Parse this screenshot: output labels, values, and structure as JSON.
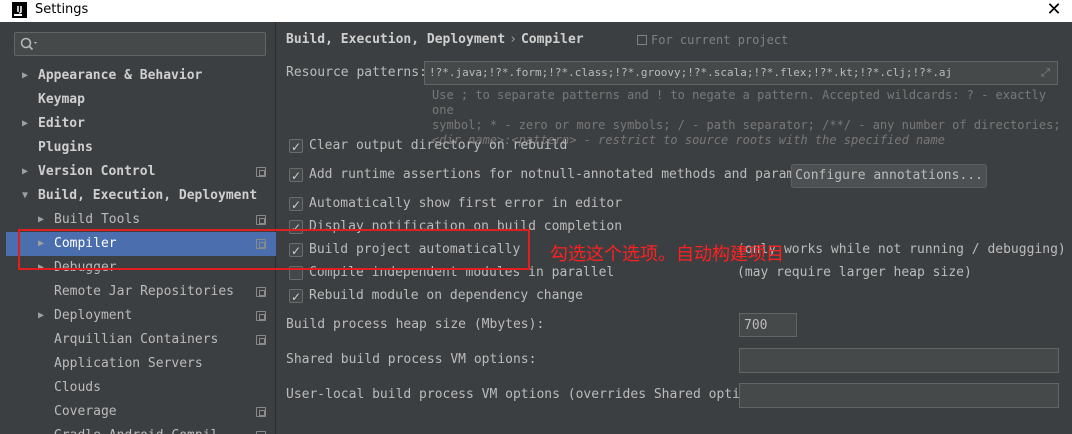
{
  "window": {
    "title": "Settings",
    "app_icon_text": "IJ",
    "close_glyph": "✕"
  },
  "sidebar": {
    "search": {
      "value": "",
      "placeholder": ""
    },
    "items": [
      {
        "label": "Appearance & Behavior",
        "expandable": true,
        "expanded": false,
        "bold": true,
        "project_icon": false,
        "level": 0
      },
      {
        "label": "Keymap",
        "expandable": false,
        "bold": true,
        "project_icon": false,
        "level": 0
      },
      {
        "label": "Editor",
        "expandable": true,
        "expanded": false,
        "bold": true,
        "project_icon": false,
        "level": 0
      },
      {
        "label": "Plugins",
        "expandable": false,
        "bold": true,
        "project_icon": false,
        "level": 0
      },
      {
        "label": "Version Control",
        "expandable": true,
        "expanded": false,
        "bold": true,
        "project_icon": true,
        "level": 0
      },
      {
        "label": "Build, Execution, Deployment",
        "expandable": true,
        "expanded": true,
        "bold": true,
        "project_icon": false,
        "level": 0
      },
      {
        "label": "Build Tools",
        "expandable": true,
        "expanded": false,
        "bold": false,
        "project_icon": true,
        "level": 1
      },
      {
        "label": "Compiler",
        "expandable": true,
        "expanded": false,
        "bold": false,
        "project_icon": true,
        "level": 1,
        "selected": true
      },
      {
        "label": "Debugger",
        "expandable": true,
        "expanded": false,
        "bold": false,
        "project_icon": false,
        "level": 1
      },
      {
        "label": "Remote Jar Repositories",
        "expandable": false,
        "bold": false,
        "project_icon": true,
        "level": 1
      },
      {
        "label": "Deployment",
        "expandable": true,
        "expanded": false,
        "bold": false,
        "project_icon": true,
        "level": 1
      },
      {
        "label": "Arquillian Containers",
        "expandable": false,
        "bold": false,
        "project_icon": true,
        "level": 1
      },
      {
        "label": "Application Servers",
        "expandable": false,
        "bold": false,
        "project_icon": false,
        "level": 1
      },
      {
        "label": "Clouds",
        "expandable": false,
        "bold": false,
        "project_icon": false,
        "level": 1
      },
      {
        "label": "Coverage",
        "expandable": false,
        "bold": false,
        "project_icon": true,
        "level": 1
      },
      {
        "label": "Gradle-Android Compil",
        "expandable": false,
        "bold": false,
        "project_icon": true,
        "level": 1
      }
    ]
  },
  "main": {
    "breadcrumb": {
      "parent": "Build, Execution, Deployment",
      "separator": "›",
      "current": "Compiler"
    },
    "for_current_project": "For current project",
    "resource_patterns": {
      "label": "Resource patterns:",
      "value": "!?*.java;!?*.form;!?*.class;!?*.groovy;!?*.scala;!?*.flex;!?*.kt;!?*.clj;!?*.aj",
      "hint_line1": "Use ; to separate patterns and ! to negate a pattern. Accepted wildcards: ? - exactly one",
      "hint_line2": "symbol; * - zero or more symbols; / - path separator; /**/ - any number of directories;",
      "hint_line3": "<dir_name>:<pattern> - restrict to source roots with the specified name"
    },
    "options": {
      "clear_output": {
        "label": "Clear output directory on rebuild",
        "checked": true
      },
      "runtime_assertions": {
        "label": "Add runtime assertions for notnull-annotated methods and parameters",
        "checked": true
      },
      "show_first_error": {
        "label": "Automatically show first error in editor",
        "checked": true
      },
      "display_notification": {
        "label": "Display notification on build completion",
        "checked": true
      },
      "build_automatically": {
        "label": "Build project automatically",
        "checked": true
      },
      "compile_parallel": {
        "label": "Compile independent modules in parallel",
        "checked": false
      },
      "rebuild_on_dependency": {
        "label": "Rebuild module on dependency change",
        "checked": true
      }
    },
    "configure_annotations_label": "Configure annotations...",
    "notes": {
      "build_auto_note": "(only works while not running / debugging)",
      "parallel_note": "(may require larger heap size)"
    },
    "heap_size": {
      "label": "Build process heap size (Mbytes):",
      "value": "700"
    },
    "shared_vm": {
      "label": "Shared build process VM options:",
      "value": ""
    },
    "user_vm": {
      "label": "User-local build process VM options (overrides Shared options):",
      "value": ""
    }
  },
  "annotation": {
    "text": "勾选这个选项。自动构建项目",
    "color": "#e02020"
  },
  "colors": {
    "background": "#3c3f41",
    "selection": "#4b6eaf",
    "text": "#bbbbbb"
  }
}
